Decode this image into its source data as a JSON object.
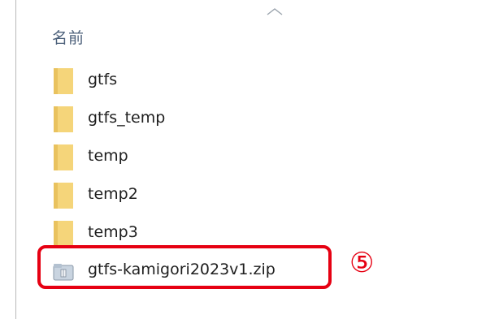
{
  "column_header": {
    "name_label": "名前",
    "sort_icon": "chevron-up-icon"
  },
  "files": [
    {
      "name": "gtfs",
      "type": "folder",
      "icon": "folder-icon"
    },
    {
      "name": "gtfs_temp",
      "type": "folder",
      "icon": "folder-icon"
    },
    {
      "name": "temp",
      "type": "folder",
      "icon": "folder-icon"
    },
    {
      "name": "temp2",
      "type": "folder",
      "icon": "folder-icon"
    },
    {
      "name": "temp3",
      "type": "folder",
      "icon": "folder-icon"
    },
    {
      "name": "gtfs-kamigori2023v1.zip",
      "type": "zip",
      "icon": "zip-archive-icon"
    }
  ],
  "annotation": {
    "marker": "⑤",
    "color": "#e60012"
  },
  "colors": {
    "folder": "#f5d57a",
    "folder_dark": "#e0b850",
    "header_text": "#4c607a"
  }
}
